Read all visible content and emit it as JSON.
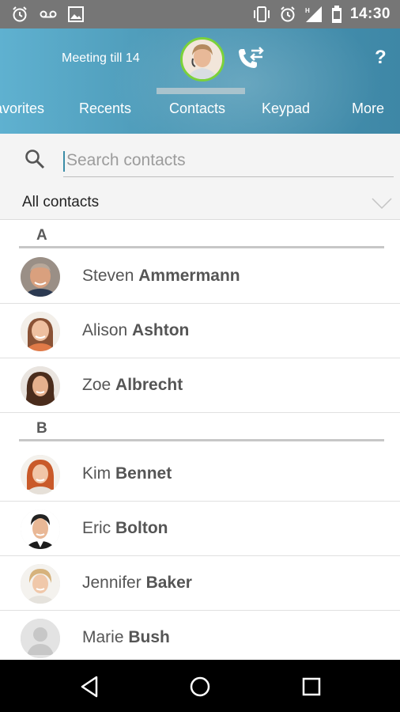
{
  "status_bar": {
    "time": "14:30",
    "left_icons": [
      "alarm-icon",
      "voicemail-icon",
      "image-icon"
    ],
    "right_icons": [
      "vibrate-icon",
      "alarm-icon",
      "signal-icon",
      "battery-icon"
    ]
  },
  "header": {
    "meeting_status": "Meeting till 14",
    "help_label": "?",
    "tabs": [
      {
        "label": "Favorites"
      },
      {
        "label": "Recents"
      },
      {
        "label": "Contacts"
      },
      {
        "label": "Keypad"
      },
      {
        "label": "More"
      }
    ],
    "active_tab": "Contacts",
    "accent_color": "#4d9ab8",
    "presence_color": "#7bd23a"
  },
  "search": {
    "placeholder": "Search contacts",
    "value": ""
  },
  "filter": {
    "selected": "All contacts"
  },
  "sections": [
    {
      "letter": "A",
      "contacts": [
        {
          "first": "Steven",
          "last": "Ammermann"
        },
        {
          "first": "Alison",
          "last": "Ashton"
        },
        {
          "first": "Zoe",
          "last": "Albrecht"
        }
      ]
    },
    {
      "letter": "B",
      "contacts": [
        {
          "first": "Kim",
          "last": "Bennet"
        },
        {
          "first": "Eric",
          "last": "Bolton"
        },
        {
          "first": "Jennifer",
          "last": "Baker"
        },
        {
          "first": "Marie",
          "last": "Bush"
        }
      ]
    }
  ]
}
